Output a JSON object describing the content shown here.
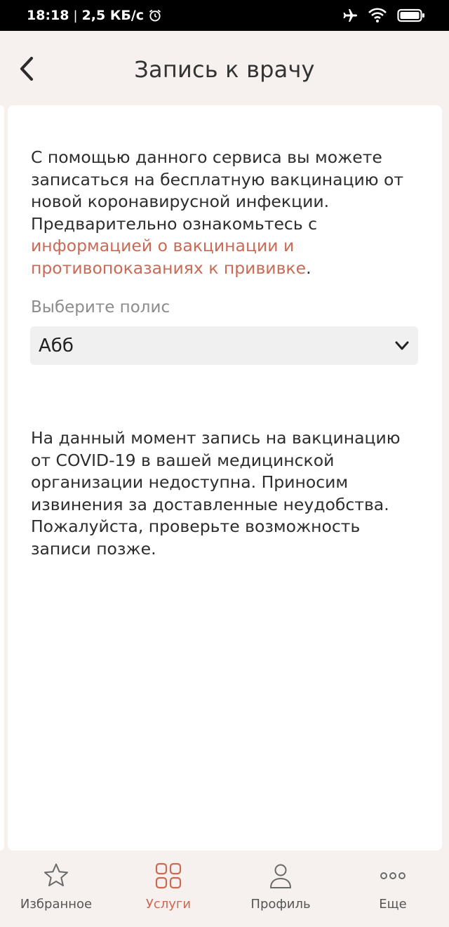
{
  "status_bar": {
    "time": "18:18",
    "separator": "|",
    "network_speed": "2,5 КБ/с"
  },
  "header": {
    "title": "Запись к врачу"
  },
  "content": {
    "intro_text": "С помощью данного сервиса вы можете записаться на бесплатную вакцинацию от новой коронавирусной инфекции. Предварительно ознакомьтесь с ",
    "intro_link": "информацией о вакцинации и противопоказаниях к прививке",
    "intro_end": ".",
    "policy_label": "Выберите полис",
    "policy_value": "Абб",
    "notice_text": "На данный момент запись на вакцинацию от COVID-19 в вашей медицинской организации недоступна. Приносим извинения за доставленные неудобства. Пожалуйста, проверьте возможность записи позже."
  },
  "bottom_nav": {
    "items": [
      {
        "label": "Избранное",
        "icon": "star-icon",
        "active": false
      },
      {
        "label": "Услуги",
        "icon": "grid-icon",
        "active": true
      },
      {
        "label": "Профиль",
        "icon": "person-icon",
        "active": false
      },
      {
        "label": "Еще",
        "icon": "more-icon",
        "active": false
      }
    ]
  },
  "colors": {
    "accent": "#c96a55",
    "background": "#f6f1ef",
    "card": "#ffffff",
    "select_bg": "#f0f0f0"
  }
}
